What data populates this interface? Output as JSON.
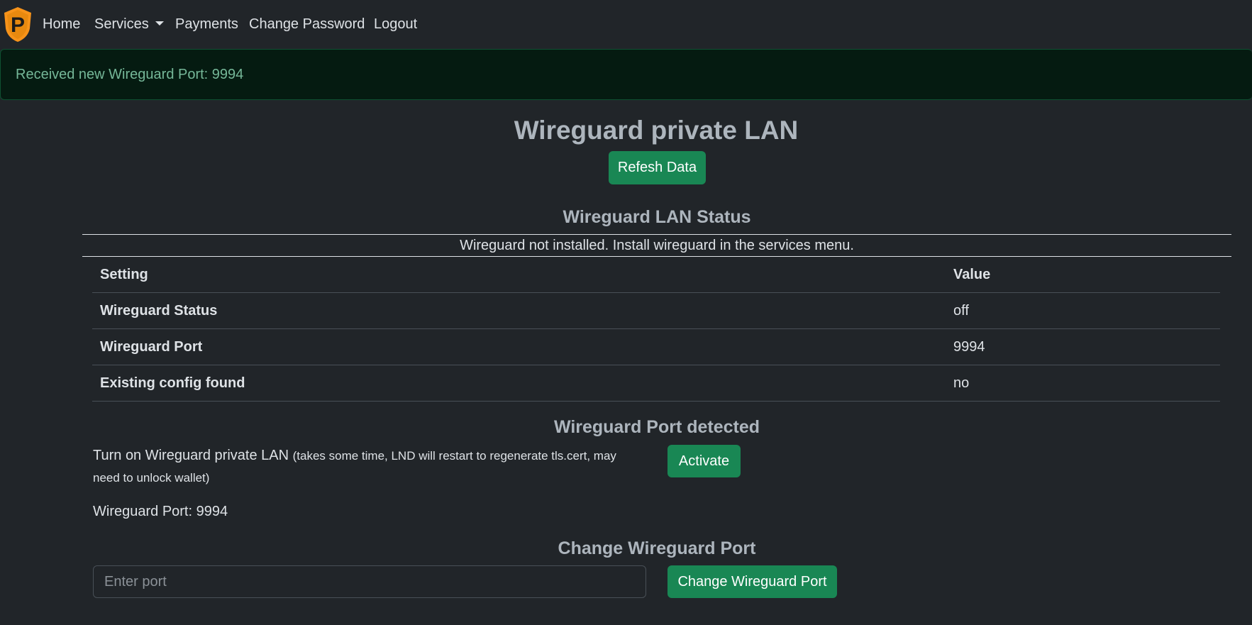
{
  "nav": {
    "logo_letter": "P",
    "home": "Home",
    "services": "Services",
    "payments": "Payments",
    "change_password": "Change Password",
    "logout": "Logout"
  },
  "alert": {
    "message": "Received new Wireguard Port: 9994"
  },
  "page": {
    "title": "Wireguard private LAN",
    "refresh_label": "Refesh Data"
  },
  "status": {
    "heading": "Wireguard LAN Status",
    "notice": "Wireguard not installed. Install wireguard in the services menu.",
    "table": {
      "header": {
        "setting": "Setting",
        "value": "Value"
      },
      "rows": [
        {
          "setting": "Wireguard Status",
          "value": "off"
        },
        {
          "setting": "Wireguard Port",
          "value": "9994"
        },
        {
          "setting": "Existing config found",
          "value": "no"
        }
      ]
    }
  },
  "detected": {
    "heading": "Wireguard Port detected",
    "activate_text": "Turn on Wireguard private LAN",
    "activate_note": "(takes some time, LND will restart to regenerate tls.cert, may need to unlock wallet)",
    "activate_label": "Activate",
    "port_line": "Wireguard Port: 9994"
  },
  "change_port": {
    "heading": "Change Wireguard Port",
    "placeholder": "Enter port",
    "button_label": "Change Wireguard Port"
  },
  "colors": {
    "background": "#212529",
    "success": "#198754",
    "alert_bg": "#051b11",
    "alert_text": "#75b798",
    "logo": "#f7931a"
  }
}
